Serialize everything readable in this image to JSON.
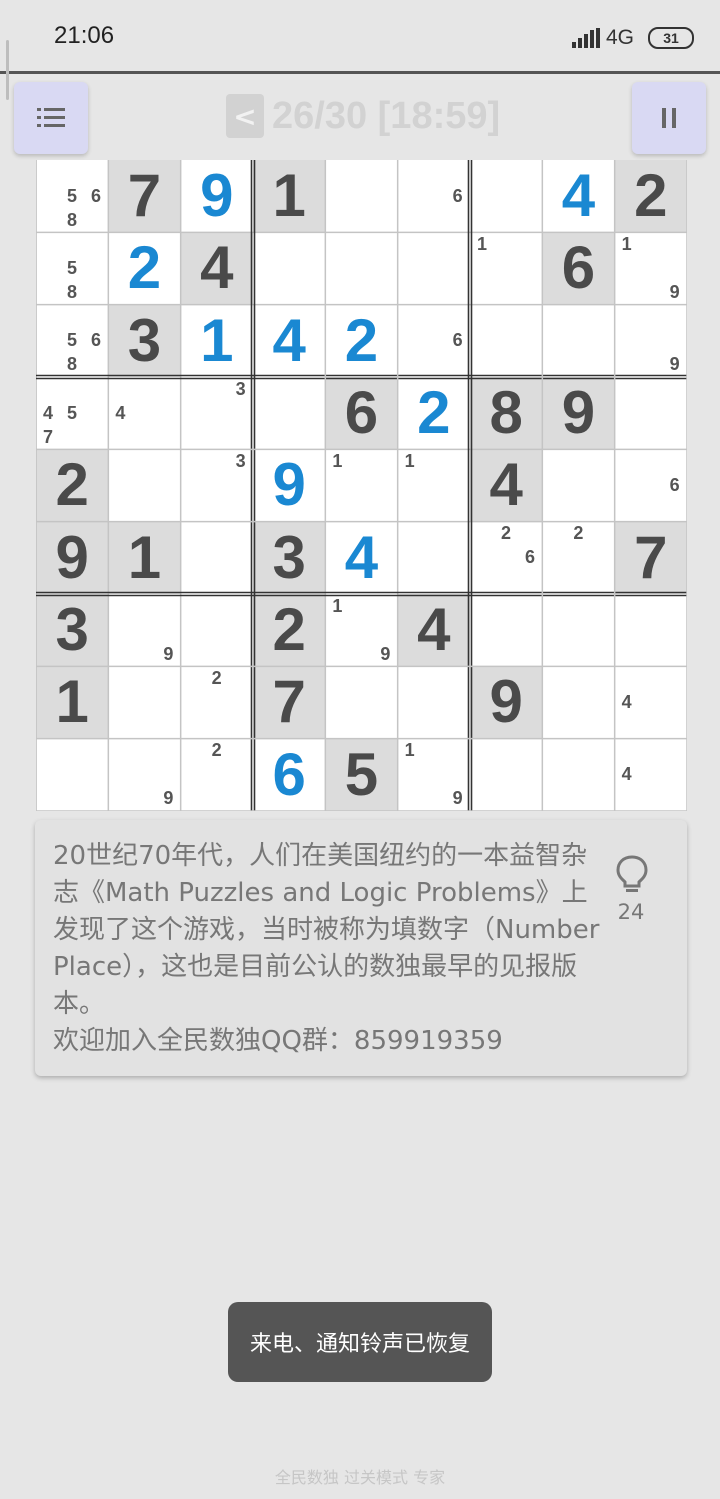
{
  "status_bar": {
    "time": "21:06",
    "network": "4G",
    "battery": "31"
  },
  "header": {
    "back_label": "<",
    "level_info": "26/30 [18:59]"
  },
  "board": [
    [
      {
        "g": 5,
        "n": "5,6,8"
      },
      {
        "g": 1,
        "v": 7
      },
      {
        "e": 1,
        "v": 9
      },
      {
        "g": 1,
        "v": 1
      },
      {
        "n": ""
      },
      {
        "n": "6"
      },
      {
        "n": ""
      },
      {
        "e": 1,
        "v": 4
      },
      {
        "g": 1,
        "v": 2
      }
    ],
    [
      {
        "n": "5,8"
      },
      {
        "e": 1,
        "v": 2
      },
      {
        "g": 1,
        "v": 4
      },
      {
        "n": ""
      },
      {
        "n": ""
      },
      {
        "n": ""
      },
      {
        "n": "1"
      },
      {
        "g": 1,
        "v": 6
      },
      {
        "n": "1,9"
      }
    ],
    [
      {
        "n": "5,6,8"
      },
      {
        "g": 1,
        "v": 3
      },
      {
        "e": 1,
        "v": 1
      },
      {
        "e": 1,
        "v": 4
      },
      {
        "e": 1,
        "v": 2
      },
      {
        "n": "6"
      },
      {
        "n": ""
      },
      {
        "n": ""
      },
      {
        "n": "9"
      }
    ],
    [
      {
        "n": "4,5,7"
      },
      {
        "n": "4"
      },
      {
        "n": "3"
      },
      {
        "n": ""
      },
      {
        "g": 1,
        "v": 6
      },
      {
        "e": 1,
        "v": 2
      },
      {
        "g": 1,
        "v": 8
      },
      {
        "g": 1,
        "v": 9
      },
      {
        "n": ""
      }
    ],
    [
      {
        "g": 1,
        "v": 2
      },
      {
        "n": ""
      },
      {
        "n": "3"
      },
      {
        "e": 1,
        "v": 9
      },
      {
        "n": "1"
      },
      {
        "n": "1"
      },
      {
        "g": 1,
        "v": 4
      },
      {
        "n": ""
      },
      {
        "n": "6"
      }
    ],
    [
      {
        "g": 1,
        "v": 9
      },
      {
        "g": 1,
        "v": 1
      },
      {
        "n": ""
      },
      {
        "g": 1,
        "v": 3
      },
      {
        "e": 1,
        "v": 4
      },
      {
        "n": ""
      },
      {
        "n": "2,6"
      },
      {
        "n": "2"
      },
      {
        "g": 1,
        "v": 7
      }
    ],
    [
      {
        "g": 1,
        "v": 3
      },
      {
        "n": "9"
      },
      {
        "n": ""
      },
      {
        "g": 1,
        "v": 2
      },
      {
        "n": "1,9"
      },
      {
        "g": 1,
        "v": 4
      },
      {
        "n": ""
      },
      {
        "n": ""
      },
      {
        "n": ""
      }
    ],
    [
      {
        "g": 1,
        "v": 1
      },
      {
        "n": ""
      },
      {
        "n": "2"
      },
      {
        "g": 1,
        "v": 7
      },
      {
        "n": ""
      },
      {
        "n": ""
      },
      {
        "g": 1,
        "v": 9
      },
      {
        "n": ""
      },
      {
        "n": "4"
      }
    ],
    [
      {
        "n": ""
      },
      {
        "n": "9"
      },
      {
        "n": "2"
      },
      {
        "e": 1,
        "v": 6
      },
      {
        "g": 1,
        "v": 5
      },
      {
        "n": "1,9"
      },
      {
        "n": ""
      },
      {
        "n": ""
      },
      {
        "n": "4"
      }
    ]
  ],
  "info": {
    "text": "20世纪70年代，人们在美国纽约的一本益智杂志《Math Puzzles and Logic Problems》上发现了这个游戏，当时被称为填数字（Number Place），这也是目前公认的数独最早的见报版本。",
    "qq_line": "欢迎加入全民数独QQ群：859919359",
    "hint_count": "24"
  },
  "toast": "来电、通知铃声已恢复",
  "footer": "全民数独 过关模式 专家",
  "colors": {
    "entered": "#1a88d2",
    "given": "#4a4a4a",
    "button_bg": "#d9d9f3"
  }
}
